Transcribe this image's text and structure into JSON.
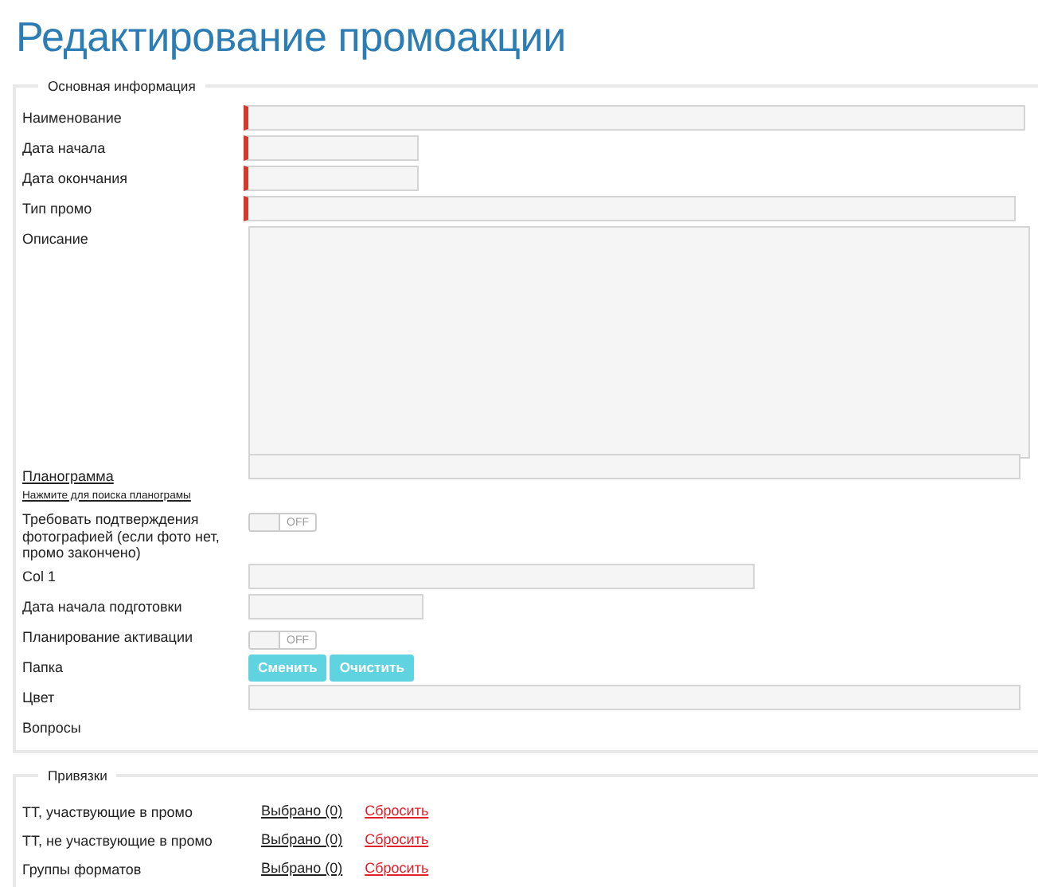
{
  "title": "Редактирование промоакции",
  "main_section": {
    "legend": "Основная информация",
    "rows": [
      {
        "kind": "input",
        "label": "Наименование",
        "required": true
      },
      {
        "kind": "input",
        "label": "Дата начала",
        "required": true
      },
      {
        "kind": "input",
        "label": "Дата окончания",
        "required": true
      },
      {
        "kind": "input",
        "label": "Тип промо",
        "required": true
      },
      {
        "kind": "textarea",
        "label": "Описание",
        "required": false
      },
      {
        "kind": "link-input",
        "label": "Планограмма",
        "hint": "Нажмите для поиска планограмы",
        "required": false
      },
      {
        "kind": "toggle",
        "label": "Требовать подтверждения фотографией (если фото нет, промо закончено)",
        "on": false,
        "toggle_text": "OFF"
      },
      {
        "kind": "input",
        "label": "Col 1",
        "required": false
      },
      {
        "kind": "input",
        "label": "Дата начала подготовки",
        "required": false
      },
      {
        "kind": "toggle",
        "label": "Планирование активации",
        "on": false,
        "toggle_text": "OFF"
      },
      {
        "kind": "buttons",
        "label": "Папка",
        "buttons": [
          "Сменить",
          "Очистить"
        ]
      },
      {
        "kind": "input",
        "label": "Цвет",
        "required": false
      },
      {
        "kind": "plain",
        "label": "Вопросы"
      }
    ]
  },
  "links_section": {
    "legend": "Привязки",
    "rows": [
      {
        "label": "ТТ, участвующие в промо",
        "selected_link": "Выбрано (0)",
        "reset_link": "Сбросить"
      },
      {
        "label": "ТТ, не участвующие в промо",
        "selected_link": "Выбрано (0)",
        "reset_link": "Сбросить"
      },
      {
        "label": "Группы форматов",
        "selected_link": "Выбрано (0)",
        "reset_link": "Сбросить"
      }
    ]
  }
}
